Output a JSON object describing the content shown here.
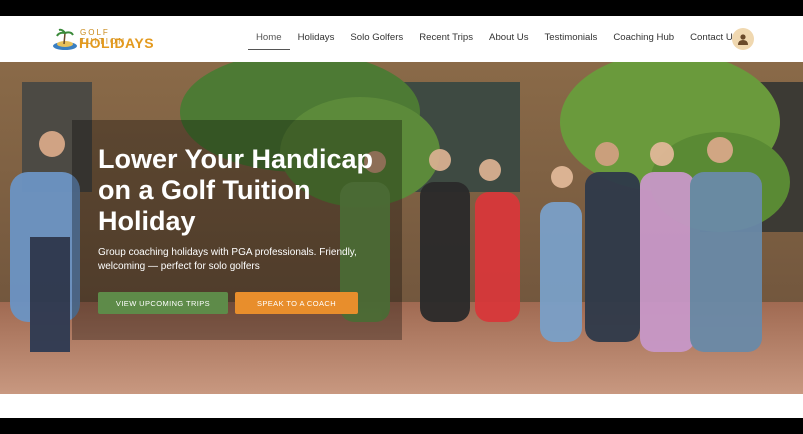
{
  "brand": {
    "logo_top": "GOLF TUITION",
    "logo_bottom": "HOLIDAYS",
    "colors": {
      "accent_green": "#5e8b49",
      "accent_orange": "#e88e2c",
      "logo_gold": "#e39a1f"
    }
  },
  "nav": {
    "items": [
      {
        "label": "Home",
        "active": true
      },
      {
        "label": "Holidays",
        "active": false
      },
      {
        "label": "Solo Golfers",
        "active": false
      },
      {
        "label": "Recent Trips",
        "active": false
      },
      {
        "label": "About Us",
        "active": false
      },
      {
        "label": "Testimonials",
        "active": false
      },
      {
        "label": "Coaching Hub",
        "active": false
      },
      {
        "label": "Contact Us",
        "active": false
      }
    ],
    "account_icon": "user-icon"
  },
  "hero": {
    "headline": "Lower Your Handicap on a Golf Tuition Holiday",
    "subtext": "Group coaching holidays with PGA professionals. Friendly, welcoming — perfect for solo golfers",
    "primary_button": "VIEW UPCOMING TRIPS",
    "secondary_button": "SPEAK TO A COACH"
  }
}
